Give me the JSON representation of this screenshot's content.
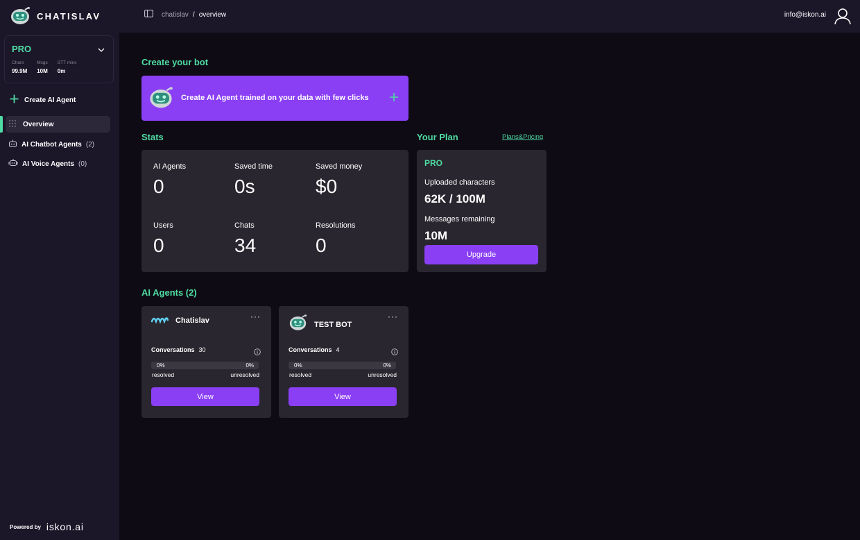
{
  "app": {
    "name": "CHATISLAV"
  },
  "plan_box": {
    "name": "PRO",
    "stats": [
      {
        "label": "Chars",
        "value": "99.9M"
      },
      {
        "label": "Msgs",
        "value": "10M"
      },
      {
        "label": "STT mins",
        "value": "0m"
      }
    ]
  },
  "sidebar": {
    "create_label": "Create AI Agent",
    "items": [
      {
        "label": "Overview",
        "count": ""
      },
      {
        "label": "AI Chatbot Agents",
        "count": "(2)"
      },
      {
        "label": "AI Voice Agents",
        "count": "(0)"
      }
    ],
    "powered_by": "Powered by",
    "powered_logo": "iskon.ai"
  },
  "breadcrumb": {
    "parent": "chatislav",
    "separator": "/",
    "current": "overview"
  },
  "user": {
    "email": "info@iskon.ai"
  },
  "main": {
    "create_title": "Create your bot",
    "banner_text": "Create AI Agent trained on your data with few clicks",
    "stats_title": "Stats",
    "stats": [
      {
        "label": "AI Agents",
        "value": "0"
      },
      {
        "label": "Saved time",
        "value": "0s"
      },
      {
        "label": "Saved money",
        "value": "$0"
      },
      {
        "label": "Users",
        "value": "0"
      },
      {
        "label": "Chats",
        "value": "34"
      },
      {
        "label": "Resolutions",
        "value": "0"
      }
    ],
    "plan_title": "Your Plan",
    "plans_link": "Plans&Pricing",
    "plan": {
      "name": "PRO",
      "uploaded_label": "Uploaded characters",
      "uploaded_value": "62K / 100M",
      "messages_label": "Messages remaining",
      "messages_value": "10M",
      "upgrade_label": "Upgrade"
    },
    "agents_title": "AI Agents (2)",
    "agents": [
      {
        "name": "Chatislav",
        "conversations_label": "Conversations",
        "conversations": "30",
        "resolved_pct": "0%",
        "unresolved_pct": "0%",
        "resolved_fraction": 0,
        "resolved_label": "resolved",
        "unresolved_label": "unresolved",
        "view_label": "View",
        "menu": "···"
      },
      {
        "name": "TEST BOT",
        "conversations_label": "Conversations",
        "conversations": "4",
        "resolved_pct": "0%",
        "unresolved_pct": "0%",
        "resolved_fraction": 0,
        "resolved_label": "resolved",
        "unresolved_label": "unresolved",
        "view_label": "View",
        "menu": "···"
      }
    ]
  },
  "colors": {
    "accent": "#4fdca2",
    "primary": "#8a3ff4",
    "sidebar": "#1c1629",
    "background": "#0e0b14",
    "card": "#29262f"
  },
  "icons": [
    "robot-logo-icon",
    "chevron-down-icon",
    "plus-icon",
    "grid-dots-icon",
    "chatbot-icon",
    "voice-agent-icon",
    "sidebar-toggle-icon",
    "user-avatar-icon",
    "wave-logo-icon",
    "info-icon"
  ]
}
